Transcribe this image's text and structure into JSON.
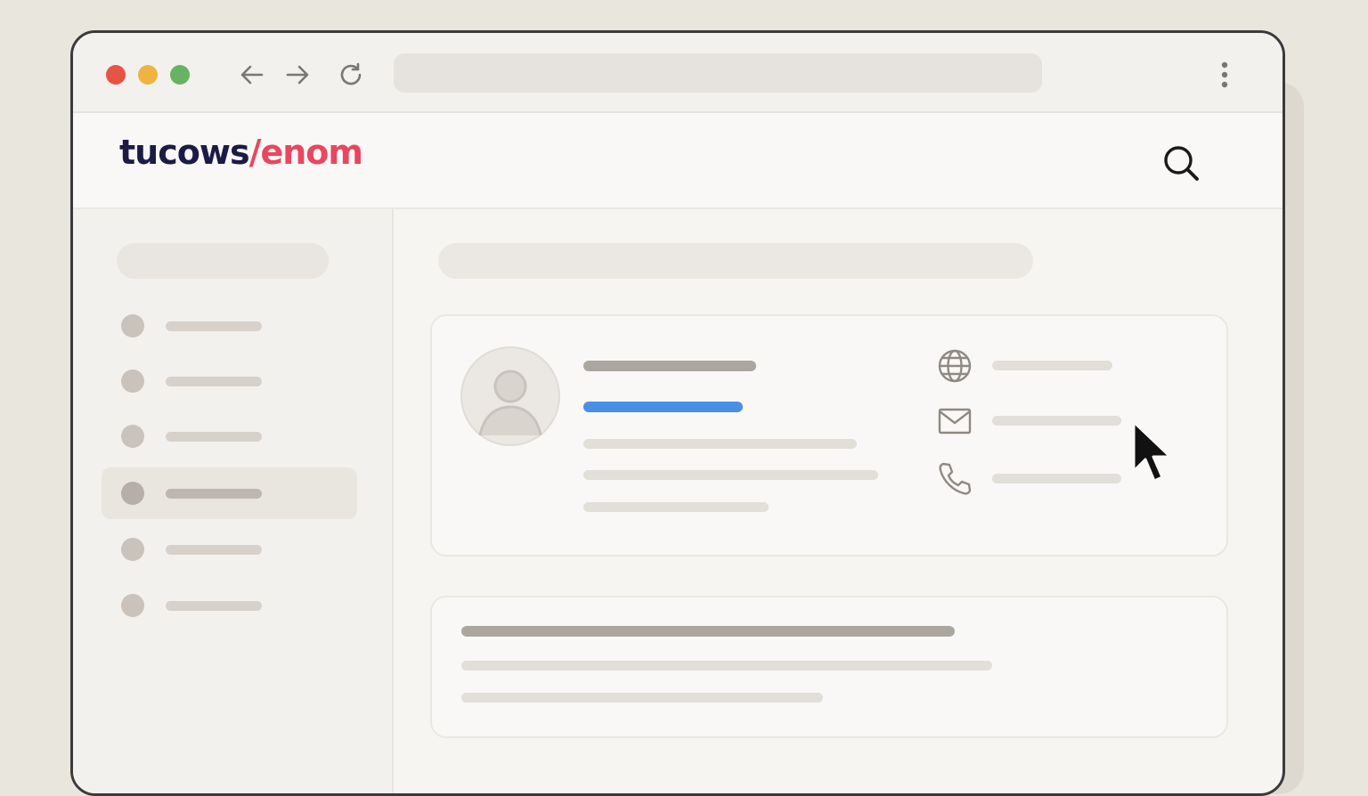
{
  "browser": {
    "address_bar_value": "",
    "traffic_lights": [
      "#e65446",
      "#edb442",
      "#68b363"
    ],
    "icons": [
      "back-arrow-icon",
      "forward-arrow-icon",
      "reload-icon",
      "kebab-menu-icon"
    ]
  },
  "header": {
    "logo_part1": "tucows",
    "logo_part2": "/enom",
    "logo_colors": {
      "part1": "#1b1b46",
      "part2": "#e8475f"
    },
    "search_icon": "search-icon"
  },
  "sidebar": {
    "items": [
      {
        "active": false
      },
      {
        "active": false
      },
      {
        "active": false
      },
      {
        "active": true
      },
      {
        "active": false
      },
      {
        "active": false
      }
    ]
  },
  "profile_card": {
    "icons": [
      "avatar-icon",
      "globe-icon",
      "mail-icon",
      "phone-icon"
    ],
    "accent_color": "#4a8fe6"
  },
  "pointer": "mouse-cursor-icon"
}
